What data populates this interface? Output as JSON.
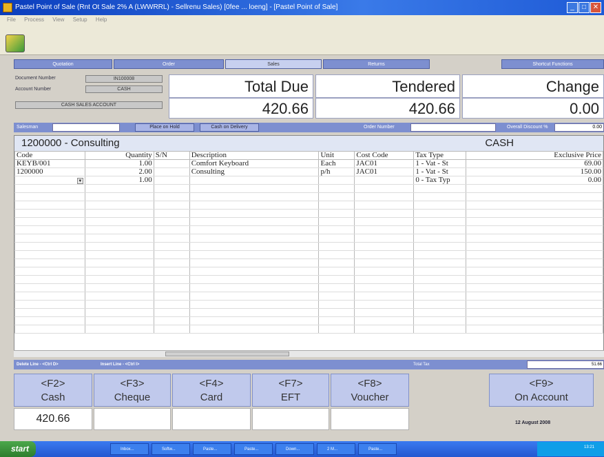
{
  "window": {
    "title": "Pastel Point of Sale (Rnt Ot Sale 2% A (LWWRRL) - Sellrenu Sales) [0fee ... loeng] - [Pastel Point of Sale]",
    "menu": [
      "File",
      "Process",
      "View",
      "Setup",
      "Help"
    ]
  },
  "tabs": [
    "Quotation",
    "Order",
    "Sales",
    "Returns",
    "Shortcut Functions"
  ],
  "active_tab": "Sales",
  "document": {
    "doc_number_label": "Document Number",
    "doc_number": "IN100008",
    "account_number_label": "Account Number",
    "account_number": "CASH",
    "account_name": "CASH SALES ACCOUNT"
  },
  "totals": {
    "total_due_label": "Total Due",
    "total_due": "420.66",
    "tendered_label": "Tendered",
    "tendered": "420.66",
    "change_label": "Change",
    "change": "0.00"
  },
  "strip": {
    "salesman_label": "Salesman",
    "place_on_hold": "Place on Hold",
    "cash_on_delivery": "Cash on Delivery",
    "order_number_label": "Order Number",
    "overall_discount_label": "Overall Discount %",
    "overall_discount": "0.00"
  },
  "item_header": {
    "item": "1200000 - Consulting",
    "account": "CASH"
  },
  "grid": {
    "columns": [
      "Code",
      "Quantity",
      "S/N",
      "Description",
      "Unit",
      "Cost Code",
      "Tax Type",
      "Exclusive Price"
    ],
    "rows": [
      {
        "code": "KEYB/001",
        "quantity": "1.00",
        "sn": "",
        "description": "Comfort Keyboard",
        "unit": "Each",
        "cost_code": "JAC01",
        "tax_type": "1 - Vat - St",
        "price": "69.00"
      },
      {
        "code": "1200000",
        "quantity": "2.00",
        "sn": "",
        "description": "Consulting",
        "unit": "p/h",
        "cost_code": "JAC01",
        "tax_type": "1 - Vat - St",
        "price": "150.00"
      },
      {
        "code": "",
        "quantity": "1.00",
        "sn": "",
        "description": "",
        "unit": "",
        "cost_code": "",
        "tax_type": "0 - Tax Typ",
        "price": "0.00"
      }
    ]
  },
  "status": {
    "delete_line": "Delete Line - <Ctrl D>",
    "insert_line": "Insert Line - <Ctrl I>",
    "total_tax_label": "Total Tax",
    "total_tax": "51.66"
  },
  "function_keys": [
    {
      "key": "<F2>",
      "label": "Cash"
    },
    {
      "key": "<F3>",
      "label": "Cheque"
    },
    {
      "key": "<F4>",
      "label": "Card"
    },
    {
      "key": "<F7>",
      "label": "EFT"
    },
    {
      "key": "<F8>",
      "label": "Voucher"
    },
    {
      "key": "<F9>",
      "label": "On Account"
    }
  ],
  "payments": {
    "cash": "420.66"
  },
  "date": "12 August 2008",
  "taskbar": {
    "start": "start",
    "items": [
      "Inbox...",
      "Softw...",
      "Paste...",
      "Paste...",
      "Down...",
      "2 M...",
      "Paste..."
    ],
    "time": "13:21"
  },
  "colors": {
    "accent": "#7d8fd0",
    "fkey_bg": "#c0c9ec",
    "titlebar": "#0a3dbd"
  }
}
